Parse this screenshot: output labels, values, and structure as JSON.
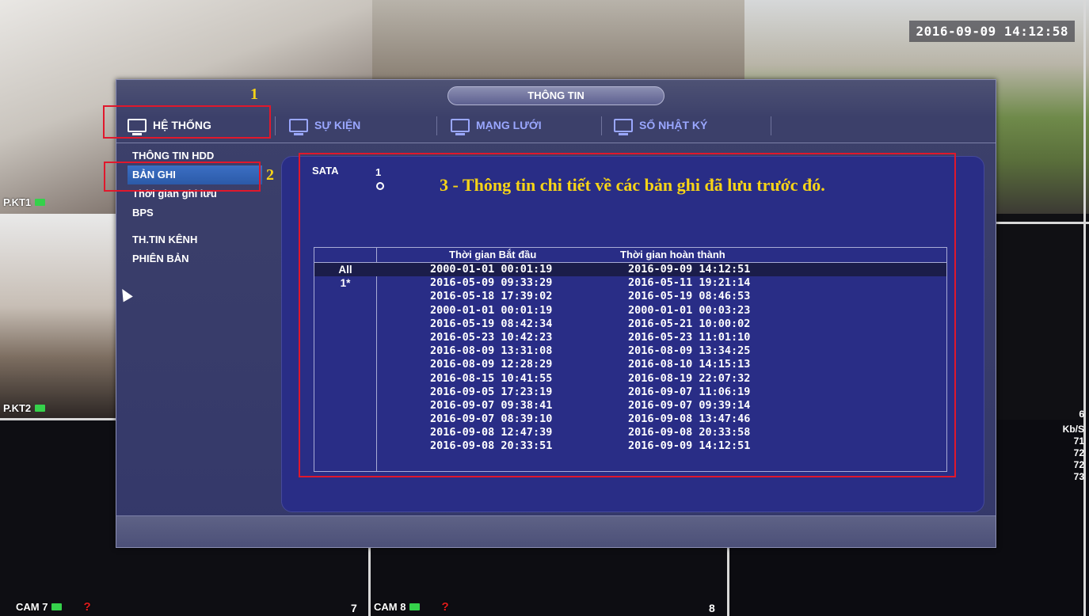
{
  "overlay": {
    "timestamp": "2016-09-09 14:12:58",
    "cameras": [
      {
        "label": "P.KT1"
      },
      {
        "label": "P.KT2"
      },
      {
        "label": "CAM 7",
        "number": "7"
      },
      {
        "label": "CAM 8",
        "number": "8"
      }
    ],
    "side_number": "6",
    "stats_header": "Kb/S",
    "stats_values": [
      "71",
      "72",
      "72",
      "73"
    ]
  },
  "dialog": {
    "title": "THÔNG TIN",
    "tabs": [
      {
        "label": "HỆ THỐNG",
        "icon": "monitor-icon",
        "active": true
      },
      {
        "label": "SỰ KIỆN",
        "icon": "event-icon",
        "active": false
      },
      {
        "label": "MẠNG LƯỚI",
        "icon": "network-icon",
        "active": false
      },
      {
        "label": "SỔ NHẬT KÝ",
        "icon": "log-icon",
        "active": false
      }
    ],
    "sidebar": [
      {
        "label": "THÔNG TIN HDD",
        "selected": false
      },
      {
        "label": "BẢN GHI",
        "selected": true
      },
      {
        "label": "Thời gian ghi lưu",
        "selected": false
      },
      {
        "label": "BPS",
        "selected": false
      },
      {
        "label": "TH.TIN KÊNH",
        "selected": false
      },
      {
        "label": "PHIÊN BẢN",
        "selected": false
      }
    ],
    "sata": {
      "label": "SATA",
      "number": "1",
      "status": "O"
    },
    "table": {
      "headers": [
        "",
        "Thời gian Bắt đầu",
        "Thời gian hoàn thành"
      ],
      "rows": [
        {
          "id": "All",
          "start": "2000-01-01 00:01:19",
          "end": "2016-09-09 14:12:51"
        },
        {
          "id": "1*",
          "start": "2016-05-09 09:33:29",
          "end": "2016-05-11 19:21:14"
        },
        {
          "id": "",
          "start": "2016-05-18 17:39:02",
          "end": "2016-05-19 08:46:53"
        },
        {
          "id": "",
          "start": "2000-01-01 00:01:19",
          "end": "2000-01-01 00:03:23"
        },
        {
          "id": "",
          "start": "2016-05-19 08:42:34",
          "end": "2016-05-21 10:00:02"
        },
        {
          "id": "",
          "start": "2016-05-23 10:42:23",
          "end": "2016-05-23 11:01:10"
        },
        {
          "id": "",
          "start": "2016-08-09 13:31:08",
          "end": "2016-08-09 13:34:25"
        },
        {
          "id": "",
          "start": "2016-08-09 12:28:29",
          "end": "2016-08-10 14:15:13"
        },
        {
          "id": "",
          "start": "2016-08-15 10:41:55",
          "end": "2016-08-19 22:07:32"
        },
        {
          "id": "",
          "start": "2016-09-05 17:23:19",
          "end": "2016-09-07 11:06:19"
        },
        {
          "id": "",
          "start": "2016-09-07 09:38:41",
          "end": "2016-09-07 09:39:14"
        },
        {
          "id": "",
          "start": "2016-09-07 08:39:10",
          "end": "2016-09-08 13:47:46"
        },
        {
          "id": "",
          "start": "2016-09-08 12:47:39",
          "end": "2016-09-08 20:33:58"
        },
        {
          "id": "",
          "start": "2016-09-08 20:33:51",
          "end": "2016-09-09 14:12:51"
        }
      ]
    }
  },
  "annotations": {
    "step1": "1",
    "step2": "2",
    "step3_text": "3 - Thông tin chi tiết về các bản ghi đã lưu trước đó."
  },
  "colors": {
    "annotation_box": "#e0182c",
    "annotation_text": "#f7d417",
    "selected_item": "#2b5aa8",
    "panel_bg": "#292d86"
  }
}
